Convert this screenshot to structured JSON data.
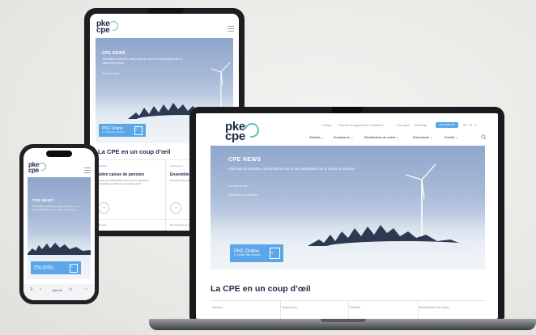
{
  "brand": {
    "logo_top": "pke",
    "logo_bottom": "cpe",
    "accent": "#5aa6e8",
    "ring_color": "#5ec3b6",
    "navy": "#1b2a44"
  },
  "laptop": {
    "topbar_links": [
      "Contact",
      "Fiche de renseignements Formulaires",
      "Pour place",
      "Newsletter"
    ],
    "lang_button": "RECHERCHE",
    "lang_codes": [
      "DE",
      "FR",
      "IT"
    ],
    "nav": [
      "Salariés",
      "Employeurs",
      "Bénéficiaires de rentes",
      "Placements",
      "Portrait"
    ],
    "hero_kicker": "CPE NEWS",
    "hero_text": "Informations actuelles, des points de vue et des publications de la caisse de pension",
    "hero_sub": "En savoir plus",
    "hero_sub2": "Toutes les nouvelles",
    "cta_title": "PKE Online",
    "cta_sub": "Le portail des assurés",
    "section_title": "La CPE en un coup d’œil",
    "columns": [
      "Salariés",
      "Employeurs",
      "Salariés",
      "Bénéficiaires de rentes"
    ]
  },
  "tablet": {
    "hero_kicker": "CPE NEWS",
    "hero_text": "Informations actuelles, des points de vue et des publications de la caisse de pension",
    "hero_sub": "En savoir plus",
    "cta_title": "PKE Online",
    "cta_sub": "Le portail des assurés",
    "section_title": "La CPE en un coup d’œil",
    "card1_kicker": "Salariés",
    "card1_title": "Votre caisse de pension",
    "card1_text": "Toutes les informations ainsi que les principaux formulaires et fiches de renseignements",
    "card2_kicker": "Employeurs",
    "card2_title": "Ensemble",
    "card2_text": "Principaux formulaires et fiches de renseignements",
    "footer_left": "Retraite",
    "footer_right": "Bénéficiaires de rentes"
  },
  "phone": {
    "hero_kicker": "CPE NEWS",
    "hero_text": "Informations actuelles, des points de vue et des publications de la caisse de pension",
    "cta_title": "PKE Online",
    "cta_sub": "Le portail des assurés",
    "url": "pke.ch"
  },
  "icons": [
    "hamburger-icon",
    "search-icon",
    "arrow-right-icon",
    "login-door-icon",
    "wind-turbine-icon",
    "reload-icon",
    "share-icon"
  ]
}
